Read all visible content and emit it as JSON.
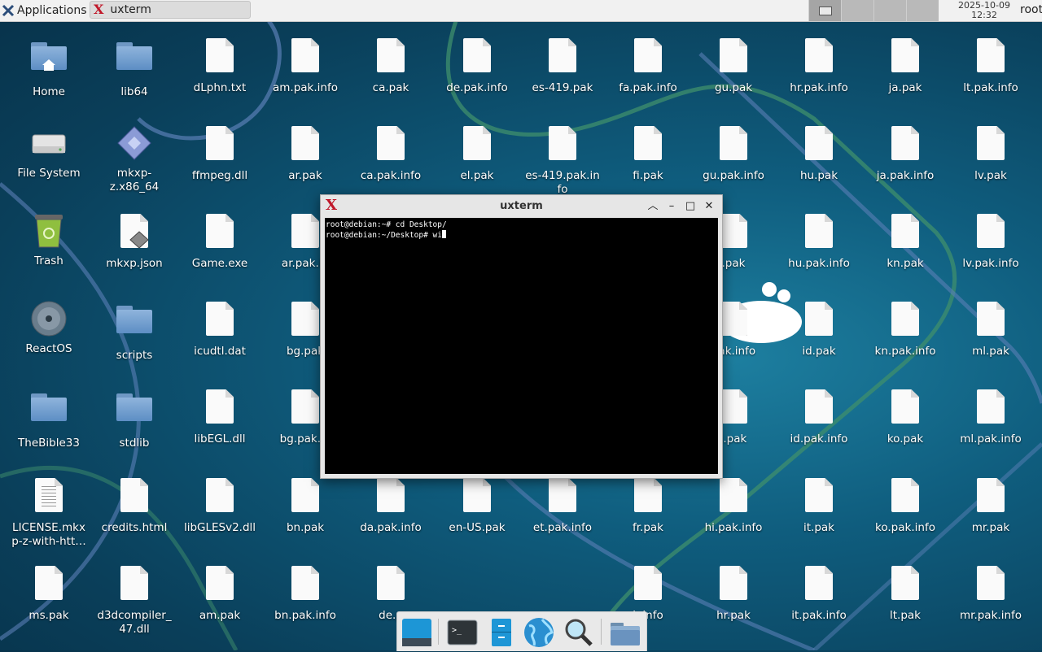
{
  "panel": {
    "applications_label": "Applications",
    "taskbar_window_title": "uxterm",
    "clock_date": "2025-10-09",
    "clock_time": "12:32",
    "user": "root"
  },
  "desktop_icons": [
    "Home",
    "lib64",
    "dLphn.txt",
    "am.pak.info",
    "ca.pak",
    "de.pak.info",
    "es-419.pak",
    "fa.pak.info",
    "gu.pak",
    "hr.pak.info",
    "ja.pak",
    "lt.pak.info",
    "File System",
    "mkxp-z.x86_64",
    "ffmpeg.dll",
    "ar.pak",
    "ca.pak.info",
    "el.pak",
    "es-419.pak.info",
    "fi.pak",
    "gu.pak.info",
    "hu.pak",
    "ja.pak.info",
    "lv.pak",
    "Trash",
    "mkxp.json",
    "Game.exe",
    "ar.pak.info",
    "e.pak",
    "hu.pak.info",
    "kn.pak",
    "lv.pak.info",
    "ReactOS",
    "scripts",
    "icudtl.dat",
    "bg.pak",
    "pak.info",
    "id.pak",
    "kn.pak.info",
    "ml.pak",
    "TheBible33",
    "stdlib",
    "libEGL.dll",
    "bg.pak.info",
    "hi.pak",
    "id.pak.info",
    "ko.pak",
    "ml.pak.info",
    "LICENSE.mkxp-z-with-htt…",
    "credits.html",
    "libGLESv2.dll",
    "bn.pak",
    "da.pak.info",
    "en-US.pak",
    "et.pak.info",
    "fr.pak",
    "hi.pak.info",
    "it.pak",
    "ko.pak.info",
    "mr.pak",
    "ms.pak",
    "d3dcompiler_47.dll",
    "am.pak",
    "bn.pak.info",
    "de.pak",
    "k.info",
    "hr.pak",
    "it.pak.info",
    "lt.pak",
    "mr.pak.info"
  ],
  "labels": {
    "r1": [
      "Home",
      "lib64",
      "dLphn.txt",
      "am.pak.info",
      "ca.pak",
      "de.pak.info",
      "es-419.pak",
      "fa.pak.info",
      "gu.pak",
      "hr.pak.info",
      "ja.pak",
      "lt.pak.info"
    ],
    "r2": [
      "File System",
      "mkxp-\nz.x86_64",
      "ffmpeg.dll",
      "ar.pak",
      "ca.pak.info",
      "el.pak",
      "es-419.pak.in\nfo",
      "fi.pak",
      "gu.pak.info",
      "hu.pak",
      "ja.pak.info",
      "lv.pak"
    ],
    "r3a": [
      "Trash",
      "mkxp.json",
      "Game.exe",
      "ar.pak.in"
    ],
    "r3b": [
      ".pak",
      "hu.pak.info",
      "kn.pak",
      "lv.pak.info"
    ],
    "r4a": [
      "ReactOS",
      "scripts",
      "icudtl.dat",
      "bg.pak"
    ],
    "r4b": [
      "pak.info",
      "id.pak",
      "kn.pak.info",
      "ml.pak"
    ],
    "r5a": [
      "TheBible33",
      "stdlib",
      "libEGL.dll",
      "bg.pak.in"
    ],
    "r5b": [
      "i.pak",
      "id.pak.info",
      "ko.pak",
      "ml.pak.info"
    ],
    "r6": [
      "LICENSE.mkx\np-z-with-htt…",
      "credits.html",
      "libGLESv2.dll",
      "bn.pak",
      "da.pak.info",
      "en-US.pak",
      "et.pak.info",
      "fr.pak",
      "hi.pak.info",
      "it.pak",
      "ko.pak.info",
      "mr.pak"
    ],
    "r7a": [
      "ms.pak",
      "d3dcompiler_\n47.dll",
      "am.pak",
      "bn.pak.info",
      "de.p"
    ],
    "r7b": [
      "k.info",
      "hr.pak",
      "it.pak.info",
      "lt.pak",
      "mr.pak.info"
    ]
  },
  "terminal": {
    "window_title": "uxterm",
    "line1": "root@debian:~# cd Desktop/",
    "line2": "root@debian:~/Desktop# wi"
  },
  "dock": {
    "items": [
      "show-desktop",
      "terminal",
      "file-manager-drawers",
      "web-browser",
      "app-finder",
      "home-folder"
    ]
  },
  "colors": {
    "accent_red": "#c0182a",
    "wallpaper": "#0f5d7e"
  }
}
